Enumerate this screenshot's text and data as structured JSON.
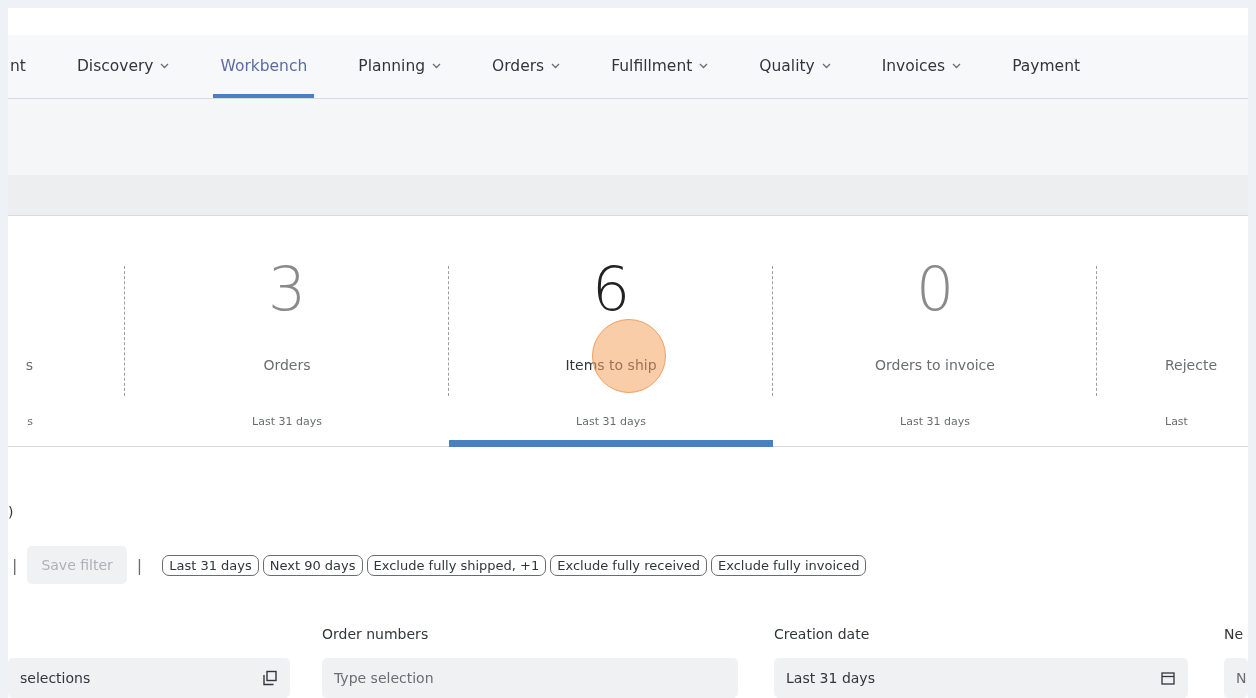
{
  "nav": {
    "items": [
      {
        "label": "nt",
        "has_menu": false,
        "selected": false
      },
      {
        "label": "Discovery",
        "has_menu": true,
        "selected": false
      },
      {
        "label": "Workbench",
        "has_menu": false,
        "selected": true
      },
      {
        "label": "Planning",
        "has_menu": true,
        "selected": false
      },
      {
        "label": "Orders",
        "has_menu": true,
        "selected": false
      },
      {
        "label": "Fulfillment",
        "has_menu": true,
        "selected": false
      },
      {
        "label": "Quality",
        "has_menu": true,
        "selected": false
      },
      {
        "label": "Invoices",
        "has_menu": true,
        "selected": false
      },
      {
        "label": "Payment",
        "has_menu": false,
        "selected": false
      }
    ]
  },
  "tiles": [
    {
      "label": "s",
      "period": "s",
      "selected": false
    },
    {
      "count": "3",
      "label": "Orders",
      "period": "Last 31 days",
      "selected": false
    },
    {
      "count": "6",
      "label": "Items to ship",
      "period": "Last 31 days",
      "selected": true
    },
    {
      "count": "0",
      "label": "Orders to invoice",
      "period": "Last 31 days",
      "selected": false
    },
    {
      "label": "Rejecte",
      "period": "Last",
      "selected": false
    }
  ],
  "result_heading": ")",
  "filter_bar": {
    "separators": [
      "|",
      "|"
    ],
    "save_filter": {
      "label": "Save filter",
      "disabled": true
    },
    "chips": [
      "Last 31 days",
      "Next 90 days",
      "Exclude fully shipped, +1",
      "Exclude fully received",
      "Exclude fully invoiced"
    ]
  },
  "fields": [
    {
      "value": "selections",
      "kind": "multi"
    },
    {
      "label": "Order numbers",
      "placeholder": "Type selection",
      "kind": "text"
    },
    {
      "label": "Creation date",
      "value": "Last 31 days",
      "kind": "date"
    },
    {
      "label": "Ne",
      "placeholder": "N",
      "kind": "text"
    }
  ]
}
